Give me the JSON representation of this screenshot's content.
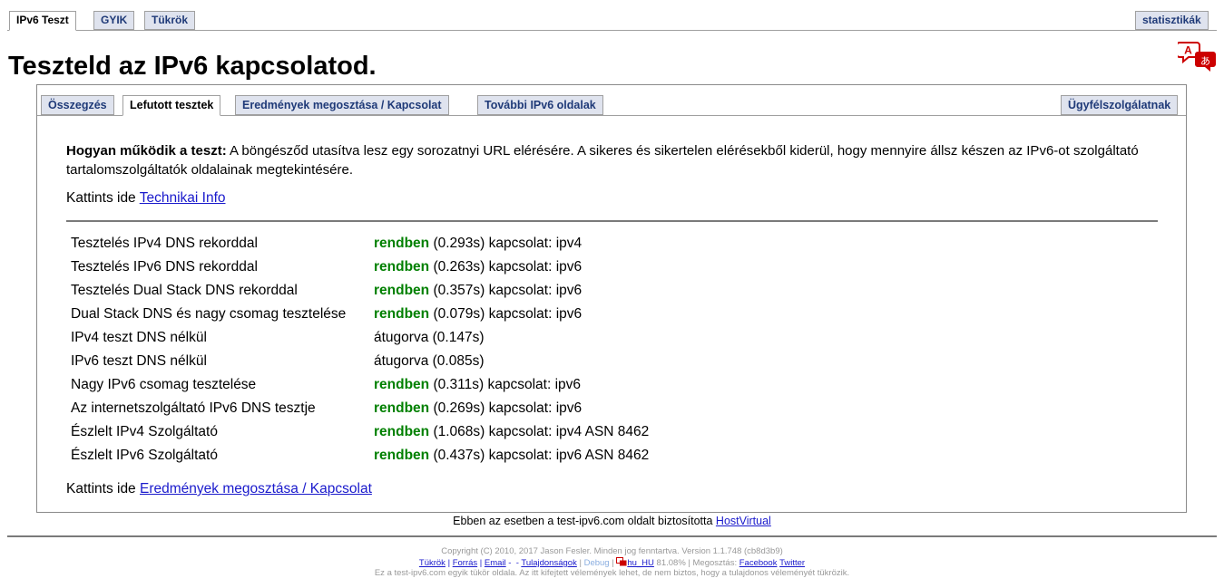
{
  "top_tabs": [
    "IPv6 Teszt",
    "GYIK",
    "Tükrök"
  ],
  "stats_tab": "statisztikák",
  "page_title": "Teszteld az IPv6 kapcsolatod.",
  "translate_icon": {
    "letters": [
      "A",
      "あ"
    ],
    "color": "#cc0000"
  },
  "inner_tabs": [
    "Összegzés",
    "Lefutott tesztek",
    "Eredmények megosztása / Kapcsolat",
    "További IPv6 oldalak"
  ],
  "support_tab": "Ügyfélszolgálatnak",
  "intro": {
    "bold": "Hogyan működik a teszt:",
    "text": " A böngésződ utasítva lesz egy sorozatnyi URL elérésére. A sikeres és sikertelen elérésekből kiderül, hogy mennyire állsz készen az IPv6-ot szolgáltató tartalomszolgáltatók oldalainak megtekintésére."
  },
  "tech_info": {
    "prefix": "Kattints ide ",
    "link": "Technikai Info"
  },
  "results": [
    {
      "label": "Tesztelés IPv4 DNS rekorddal",
      "status": "rendben",
      "detail": " (0.293s) kapcsolat: ipv4"
    },
    {
      "label": "Tesztelés IPv6 DNS rekorddal",
      "status": "rendben",
      "detail": " (0.263s) kapcsolat: ipv6"
    },
    {
      "label": "Tesztelés Dual Stack DNS rekorddal",
      "status": "rendben",
      "detail": " (0.357s) kapcsolat: ipv6"
    },
    {
      "label": "Dual Stack DNS és nagy csomag tesztelése",
      "status": "rendben",
      "detail": " (0.079s) kapcsolat: ipv6"
    },
    {
      "label": "IPv4 teszt DNS nélkül",
      "status": "",
      "detail": "átugorva (0.147s)"
    },
    {
      "label": "IPv6 teszt DNS nélkül",
      "status": "",
      "detail": "átugorva (0.085s)"
    },
    {
      "label": "Nagy IPv6 csomag tesztelése",
      "status": "rendben",
      "detail": " (0.311s) kapcsolat: ipv6"
    },
    {
      "label": "Az internetszolgáltató IPv6 DNS tesztje",
      "status": "rendben",
      "detail": " (0.269s) kapcsolat: ipv6"
    },
    {
      "label": "Észlelt IPv4 Szolgáltató",
      "status": "rendben",
      "detail": " (1.068s) kapcsolat: ipv4 ASN 8462"
    },
    {
      "label": "Észlelt IPv6 Szolgáltató",
      "status": "rendben",
      "detail": " (0.437s) kapcsolat: ipv6 ASN 8462"
    }
  ],
  "share": {
    "prefix": "Kattints ide ",
    "link": "Eredmények megosztása / Kapcsolat"
  },
  "sponsor": {
    "text": "Ebben az esetben a test-ipv6.com oldalt biztosította ",
    "link": "HostVirtual"
  },
  "footer": {
    "copyright": "Copyright (C) 2010, 2017 Jason Fesler. Minden jog fenntartva. Version 1.1.748 (cb8d3b9)",
    "links": {
      "mirrors": "Tükrök",
      "sources": "Forrás",
      "email": "Email",
      "owners": "Tulajdonságok",
      "debug": "Debug",
      "locale": "hu_HU",
      "percent": " 81.08% | Megosztás: ",
      "facebook": "Facebook",
      "twitter": "Twitter"
    },
    "disclaimer": "Ez a test-ipv6.com egyik tükör oldala. Az itt kifejtett vélemények lehet, de nem biztos, hogy a tulajdonos véleményét tükrözik."
  },
  "colors": {
    "ok": "#008000",
    "link": "#1a1acc",
    "tab_bg": "#dfe3ee",
    "tab_text": "#1f3a78"
  }
}
